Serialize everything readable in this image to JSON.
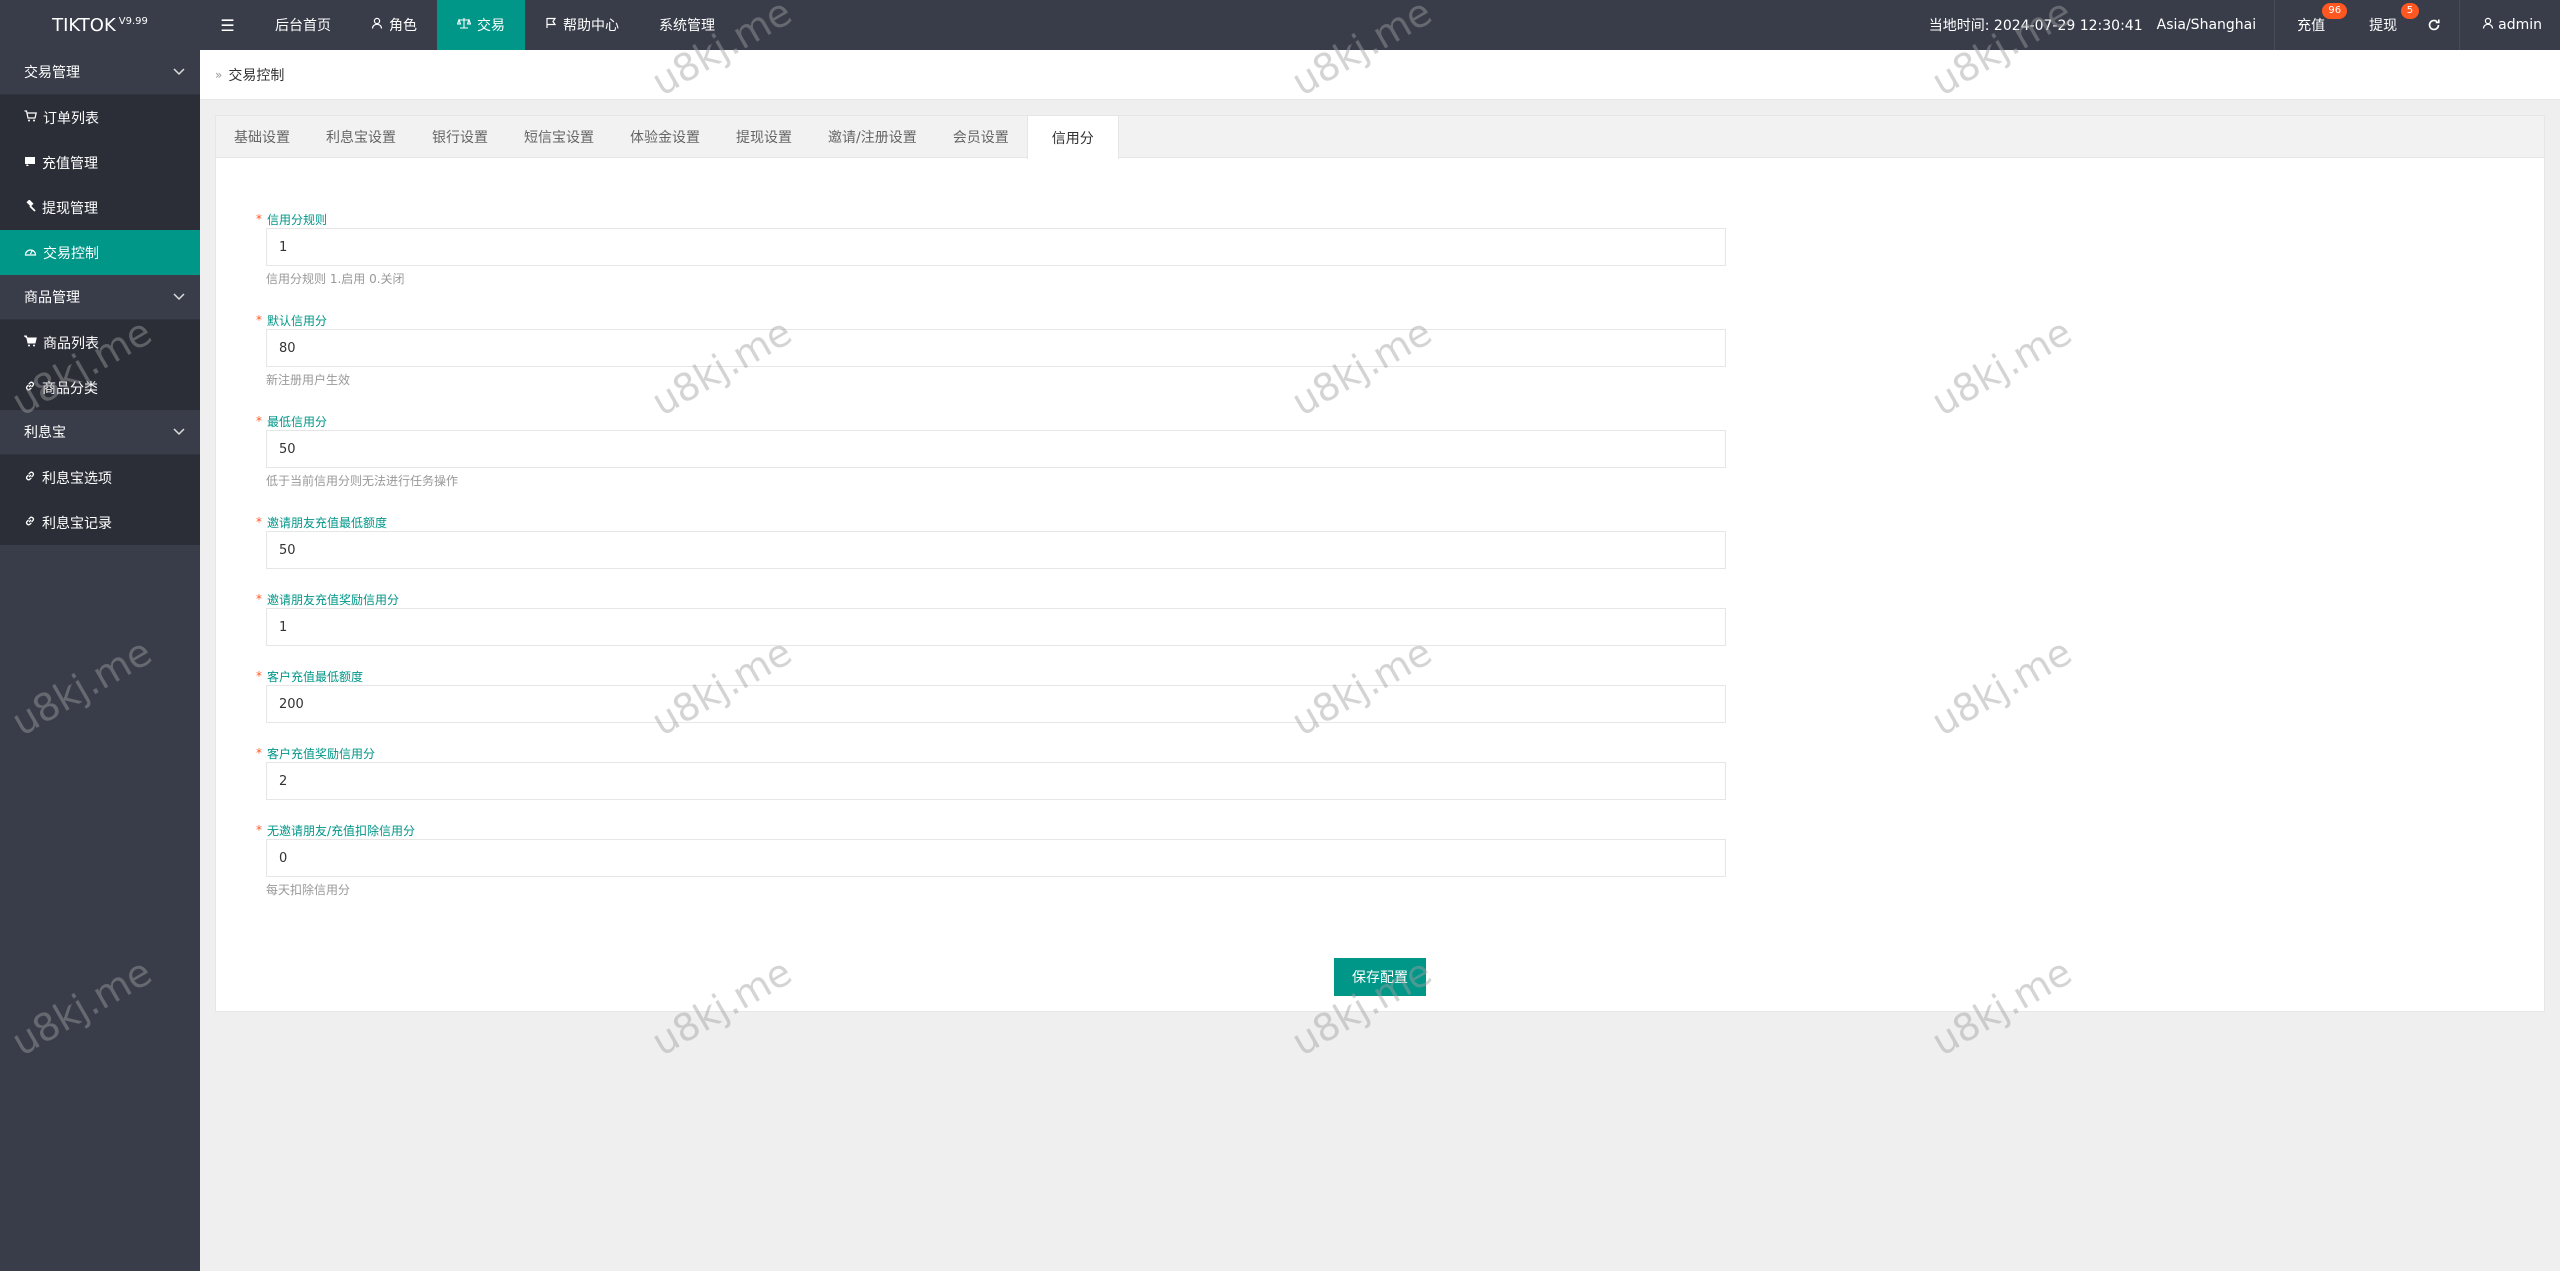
{
  "header": {
    "logo": "TIKTOK",
    "version": "V9.99",
    "menu_toggle_icon": "menu-icon",
    "nav": [
      {
        "label": "后台首页",
        "icon": ""
      },
      {
        "label": "角色",
        "icon": "user-icon"
      },
      {
        "label": "交易",
        "icon": "scale-icon",
        "active": true
      },
      {
        "label": "帮助中心",
        "icon": "flag-icon"
      },
      {
        "label": "系统管理",
        "icon": ""
      }
    ],
    "time_text": "当地时间: 2024-07-29 12:30:41",
    "timezone": "Asia/Shanghai",
    "recharge_label": "充值",
    "recharge_badge": "96",
    "withdraw_label": "提现",
    "withdraw_badge": "5",
    "refresh_icon": "refresh-icon",
    "user_label": "admin"
  },
  "sidebar": {
    "groups": [
      {
        "label": "交易管理",
        "items": [
          {
            "label": "订单列表",
            "icon": "cart-icon"
          },
          {
            "label": "充值管理",
            "icon": "money-icon"
          },
          {
            "label": "提现管理",
            "icon": "gavel-icon"
          },
          {
            "label": "交易控制",
            "icon": "dashboard-icon",
            "active": true
          }
        ]
      },
      {
        "label": "商品管理",
        "items": [
          {
            "label": "商品列表",
            "icon": "cart-icon"
          },
          {
            "label": "商品分类",
            "icon": "link-icon"
          }
        ]
      },
      {
        "label": "利息宝",
        "items": [
          {
            "label": "利息宝选项",
            "icon": "link-icon"
          },
          {
            "label": "利息宝记录",
            "icon": "link-icon"
          }
        ]
      }
    ]
  },
  "breadcrumb": {
    "current": "交易控制"
  },
  "tabs": [
    "基础设置",
    "利息宝设置",
    "银行设置",
    "短信宝设置",
    "体验金设置",
    "提现设置",
    "邀请/注册设置",
    "会员设置",
    "信用分"
  ],
  "active_tab": 8,
  "form": {
    "fields": [
      {
        "label": "信用分规则",
        "value": "1",
        "hint": "信用分规则 1.启用 0.关闭"
      },
      {
        "label": "默认信用分",
        "value": "80",
        "hint": "新注册用户生效"
      },
      {
        "label": "最低信用分",
        "value": "50",
        "hint": "低于当前信用分则无法进行任务操作"
      },
      {
        "label": "邀请朋友充值最低额度",
        "value": "50",
        "hint": ""
      },
      {
        "label": "邀请朋友充值奖励信用分",
        "value": "1",
        "hint": ""
      },
      {
        "label": "客户充值最低额度",
        "value": "200",
        "hint": ""
      },
      {
        "label": "客户充值奖励信用分",
        "value": "2",
        "hint": ""
      },
      {
        "label": "无邀请朋友/充值扣除信用分",
        "value": "0",
        "hint": "每天扣除信用分"
      }
    ],
    "save_label": "保存配置"
  },
  "watermark": "u8kj.me",
  "colors": {
    "header": "#393d49",
    "accent": "#009688",
    "badge": "#ff5722"
  }
}
